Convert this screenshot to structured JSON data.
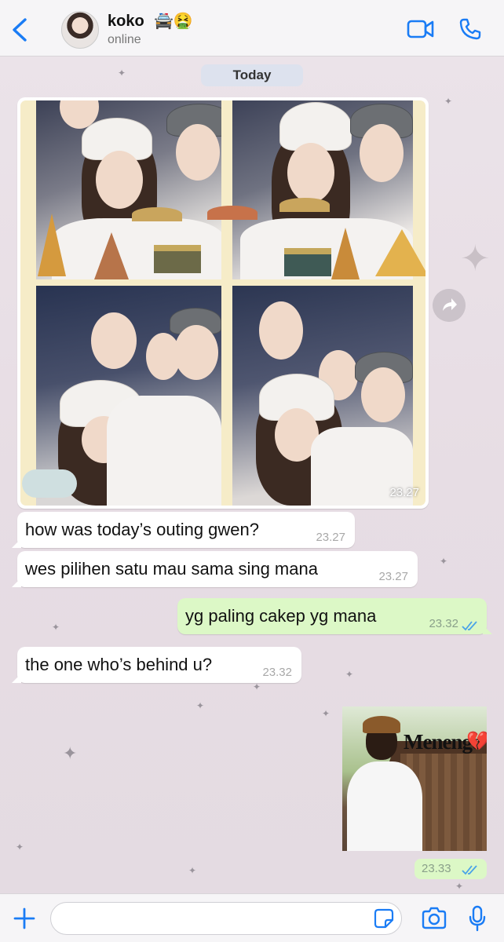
{
  "header": {
    "back_icon": "chevron-left-icon",
    "contact_name": "koko",
    "contact_emoji": "🚔🤮",
    "status": "online",
    "video_icon": "video-camera-icon",
    "phone_icon": "phone-icon"
  },
  "chat": {
    "date_label": "Today",
    "photo_message": {
      "time": "23.27",
      "forward_icon": "forward-share-icon"
    },
    "messages": [
      {
        "direction": "in",
        "text": "how was today’s outing gwen?",
        "time": "23.27"
      },
      {
        "direction": "in",
        "text": "wes pilihen satu mau sama sing mana",
        "time": "23.27"
      },
      {
        "direction": "out",
        "text": "yg paling cakep yg mana",
        "time": "23.32",
        "status": "read"
      },
      {
        "direction": "in",
        "text": "the one who’s behind u?",
        "time": "23.32"
      }
    ],
    "sticker": {
      "caption": "Menengo",
      "heart": "💔",
      "time": "23.33",
      "status": "read"
    }
  },
  "composer": {
    "plus_icon": "plus-icon",
    "input_value": "",
    "input_placeholder": "",
    "sticker_icon": "sticker-icon",
    "camera_icon": "camera-icon",
    "mic_icon": "microphone-icon"
  },
  "colors": {
    "accent": "#1a7cf5",
    "incoming_bubble": "#ffffff",
    "outgoing_bubble": "#dcf8c6",
    "read_ticks": "#4aa3e8",
    "chat_background": "#ebe3e9"
  }
}
